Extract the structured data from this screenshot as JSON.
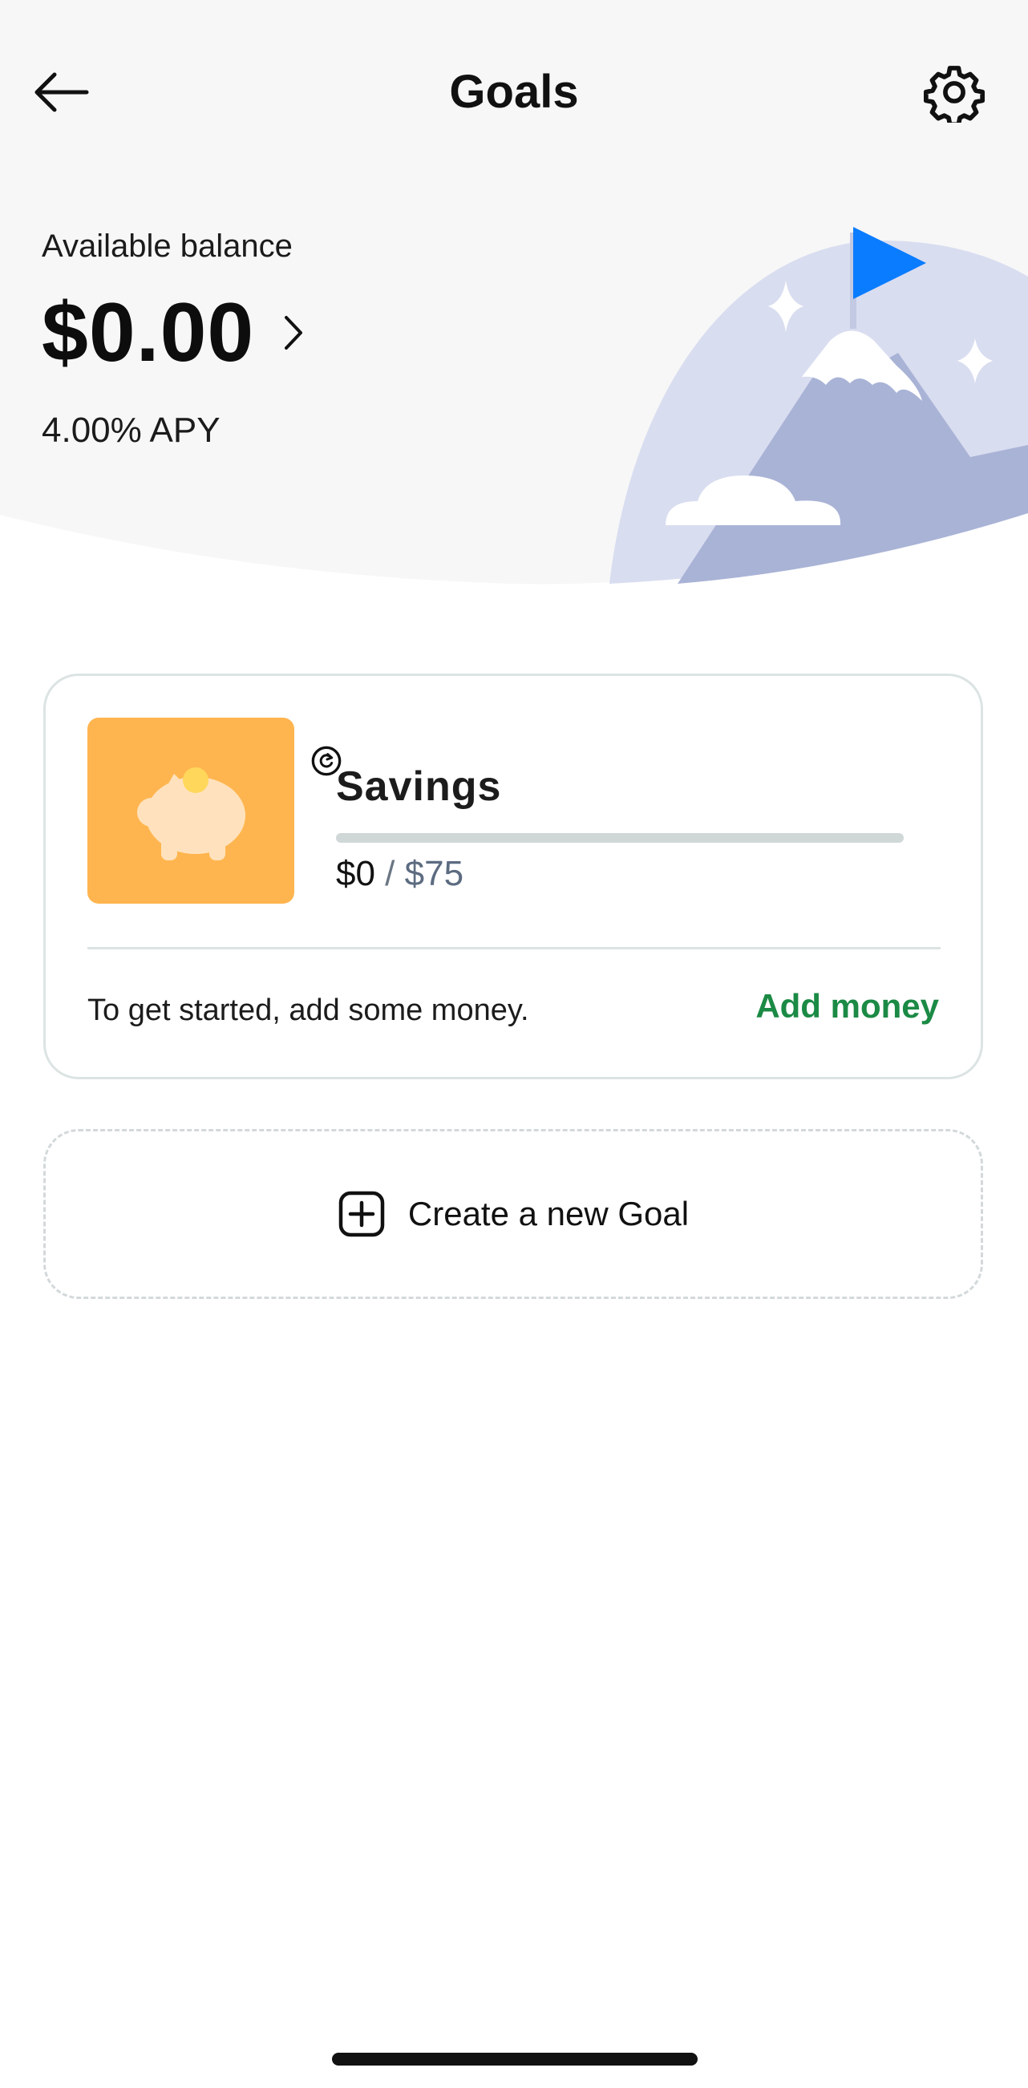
{
  "header": {
    "title": "Goals",
    "back_icon": "back-arrow-icon",
    "settings_icon": "gear-icon"
  },
  "balance": {
    "label": "Available balance",
    "amount": "$0.00",
    "apy": "4.00% APY"
  },
  "goals": [
    {
      "name": "Savings",
      "current": "$0",
      "separator": " / ",
      "target": "$75",
      "progress": 0,
      "icon": "piggy-bank-icon",
      "badge_icon": "sync-icon",
      "hint": "To get started, add some money.",
      "action_label": "Add money"
    }
  ],
  "create_goal": {
    "label": "Create a new Goal",
    "icon": "plus-square-icon"
  },
  "colors": {
    "accent_green": "#1b8a45",
    "goal_tile": "#ffb54f",
    "flag_blue": "#0a7cff",
    "mountain": "#a9b3d6",
    "sky": "#d9ddf0",
    "header_bg": "#f7f7f7"
  }
}
